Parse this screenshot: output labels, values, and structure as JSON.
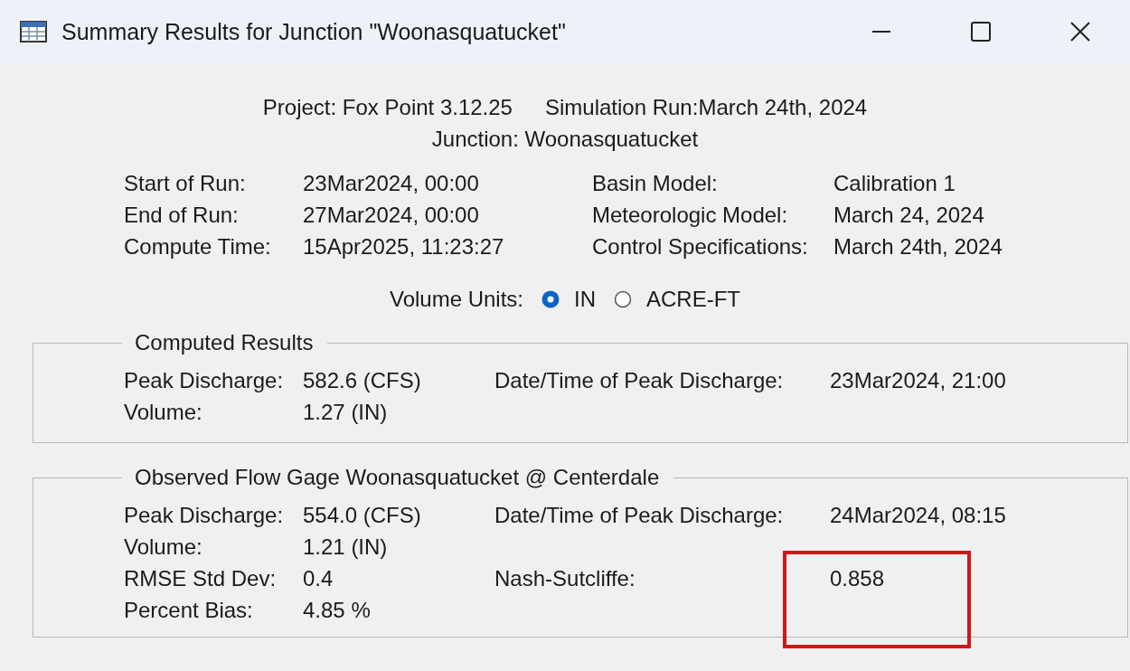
{
  "window": {
    "title": "Summary Results for Junction \"Woonasquatucket\""
  },
  "header": {
    "project_label": "Project:",
    "project": "Fox Point 3.12.25",
    "run_label": "Simulation Run:",
    "run": "March 24th, 2024",
    "junction_label": "Junction:",
    "junction": "Woonasquatucket"
  },
  "run_info": [
    {
      "label": "Start of Run:",
      "value": "23Mar2024, 00:00",
      "label_2": "Basin Model:",
      "value_2": "Calibration 1"
    },
    {
      "label": "End of Run:",
      "value": "27Mar2024, 00:00",
      "label_2": "Meteorologic Model:",
      "value_2": "March 24, 2024"
    },
    {
      "label": "Compute Time:",
      "value": "15Apr2025, 11:23:27",
      "label_2": "Control Specifications:",
      "value_2": "March 24th, 2024"
    }
  ],
  "volume_units": {
    "label": "Volume Units:",
    "options": [
      {
        "label": "IN",
        "selected": true
      },
      {
        "label": "ACRE-FT",
        "selected": false
      }
    ]
  },
  "groups": [
    {
      "title": "Computed Results",
      "rows": [
        {
          "label": "Peak Discharge:",
          "value": "582.6 (CFS)",
          "label_2": "Date/Time of Peak Discharge:",
          "value_2": "23Mar2024, 21:00"
        },
        {
          "label": "Volume:",
          "value": "1.27 (IN)"
        }
      ]
    },
    {
      "title": "Observed Flow Gage Woonasquatucket @ Centerdale",
      "rows": [
        {
          "label": "Peak Discharge:",
          "value": "554.0 (CFS)",
          "label_2": "Date/Time of Peak Discharge:",
          "value_2": "24Mar2024, 08:15"
        },
        {
          "label": "Volume:",
          "value": "1.21 (IN)"
        },
        {
          "label": "RMSE Std Dev:",
          "value": "0.4",
          "label_2": "Nash-Sutcliffe:",
          "value_2": "0.858",
          "highlight": true
        },
        {
          "label": "Percent Bias:",
          "value": "4.85 %"
        }
      ]
    }
  ]
}
